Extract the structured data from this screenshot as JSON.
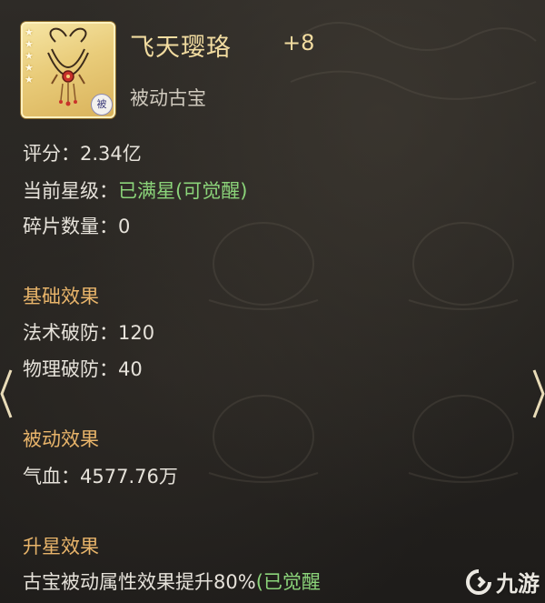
{
  "item": {
    "name": "飞天璎珞",
    "level": "+8",
    "type": "被动古宝",
    "badge": "被",
    "stars": 5,
    "icon": "necklace-icon"
  },
  "stats": {
    "score_label": "评分：",
    "score_value": "2.34亿",
    "star_label": "当前星级：",
    "star_value": "已满星(可觉醒)",
    "fragment_label": "碎片数量：",
    "fragment_value": "0"
  },
  "base_effect": {
    "title": "基础效果",
    "items": [
      {
        "label": "法术破防：",
        "value": "120"
      },
      {
        "label": "物理破防：",
        "value": "40"
      }
    ]
  },
  "passive_effect": {
    "title": "被动效果",
    "items": [
      {
        "label": "气血：",
        "value": "4577.76万"
      }
    ]
  },
  "star_up_effect": {
    "title": "升星效果",
    "text": "古宝被动属性效果提升80%",
    "status": "(已觉醒"
  },
  "watermark": "九游",
  "colors": {
    "title_gold": "#f2dca0",
    "section_orange": "#e8b46a",
    "awaken_green": "#8bd47a"
  }
}
